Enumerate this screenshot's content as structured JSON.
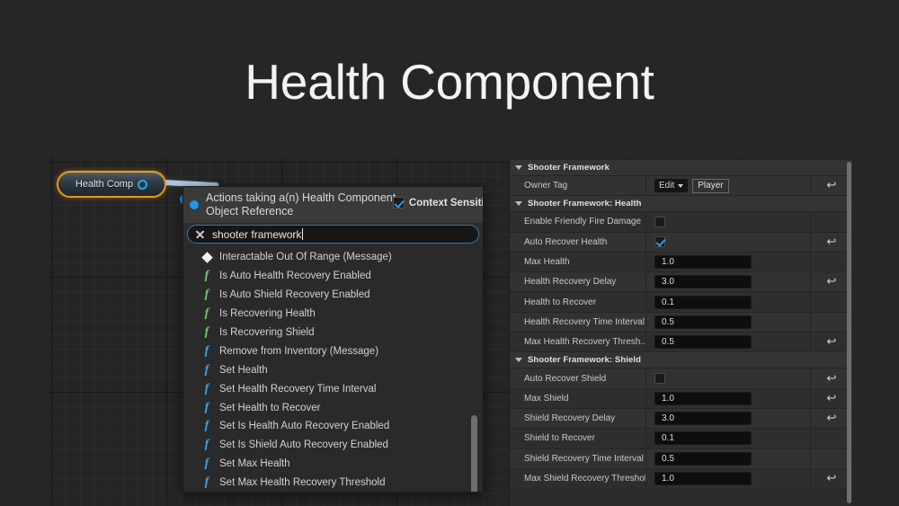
{
  "slide": {
    "title": "Health Component"
  },
  "blueprint": {
    "node": {
      "label": "Health Comp",
      "pin_icon": "circle-pin-icon"
    }
  },
  "context_menu": {
    "header_title": "Actions taking a(n) Health Component Object Reference",
    "context_sensitive_label": "Context Sensitiv",
    "context_sensitive_checked": true,
    "search": {
      "value": "shooter framework",
      "clear_icon": "close-icon"
    },
    "items": [
      {
        "label": "Interactable Out Of Range (Message)",
        "icon": "message-diamond-icon",
        "icon_color": "white"
      },
      {
        "label": "Is Auto Health Recovery Enabled",
        "icon": "function-icon",
        "icon_color": "green"
      },
      {
        "label": "Is Auto Shield Recovery Enabled",
        "icon": "function-icon",
        "icon_color": "green"
      },
      {
        "label": "Is Recovering Health",
        "icon": "function-icon",
        "icon_color": "green"
      },
      {
        "label": "Is Recovering Shield",
        "icon": "function-icon",
        "icon_color": "green"
      },
      {
        "label": "Remove from Inventory (Message)",
        "icon": "function-icon",
        "icon_color": "blue"
      },
      {
        "label": "Set Health",
        "icon": "function-icon",
        "icon_color": "blue"
      },
      {
        "label": "Set Health Recovery Time Interval",
        "icon": "function-icon",
        "icon_color": "blue"
      },
      {
        "label": "Set Health to Recover",
        "icon": "function-icon",
        "icon_color": "blue"
      },
      {
        "label": "Set Is Health Auto Recovery Enabled",
        "icon": "function-icon",
        "icon_color": "blue"
      },
      {
        "label": "Set Is Shield Auto Recovery Enabled",
        "icon": "function-icon",
        "icon_color": "blue"
      },
      {
        "label": "Set Max Health",
        "icon": "function-icon",
        "icon_color": "blue"
      },
      {
        "label": "Set Max Health Recovery Threshold",
        "icon": "function-icon",
        "icon_color": "blue"
      }
    ]
  },
  "details": {
    "sections": [
      {
        "title": "Shooter Framework",
        "rows": [
          {
            "label": "Owner Tag",
            "type": "tag",
            "edit_label": "Edit",
            "tag_value": "Player",
            "reset": true
          }
        ]
      },
      {
        "title": "Shooter Framework: Health",
        "rows": [
          {
            "label": "Enable Friendly Fire Damage",
            "type": "checkbox",
            "checked": false,
            "reset": false
          },
          {
            "label": "Auto Recover Health",
            "type": "checkbox",
            "checked": true,
            "reset": true
          },
          {
            "label": "Max Health",
            "type": "number",
            "value": "1.0",
            "reset": false
          },
          {
            "label": "Health Recovery Delay",
            "type": "number",
            "value": "3.0",
            "reset": true
          },
          {
            "label": "Health to Recover",
            "type": "number",
            "value": "0.1",
            "reset": false
          },
          {
            "label": "Health Recovery Time Interval",
            "type": "number",
            "value": "0.5",
            "reset": false
          },
          {
            "label": "Max Health Recovery Thresh...",
            "type": "number",
            "value": "0.5",
            "reset": true
          }
        ]
      },
      {
        "title": "Shooter Framework: Shield",
        "rows": [
          {
            "label": "Auto Recover Shield",
            "type": "checkbox",
            "checked": false,
            "reset": true
          },
          {
            "label": "Max Shield",
            "type": "number",
            "value": "1.0",
            "reset": true
          },
          {
            "label": "Shield Recovery Delay",
            "type": "number",
            "value": "3.0",
            "reset": true
          },
          {
            "label": "Shield to Recover",
            "type": "number",
            "value": "0.1",
            "reset": false
          },
          {
            "label": "Shield Recovery Time Interval",
            "type": "number",
            "value": "0.5",
            "reset": false
          },
          {
            "label": "Max Shield Recovery Threshold",
            "type": "number",
            "value": "1.0",
            "reset": true
          }
        ]
      }
    ],
    "reset_glyph": "↩"
  }
}
